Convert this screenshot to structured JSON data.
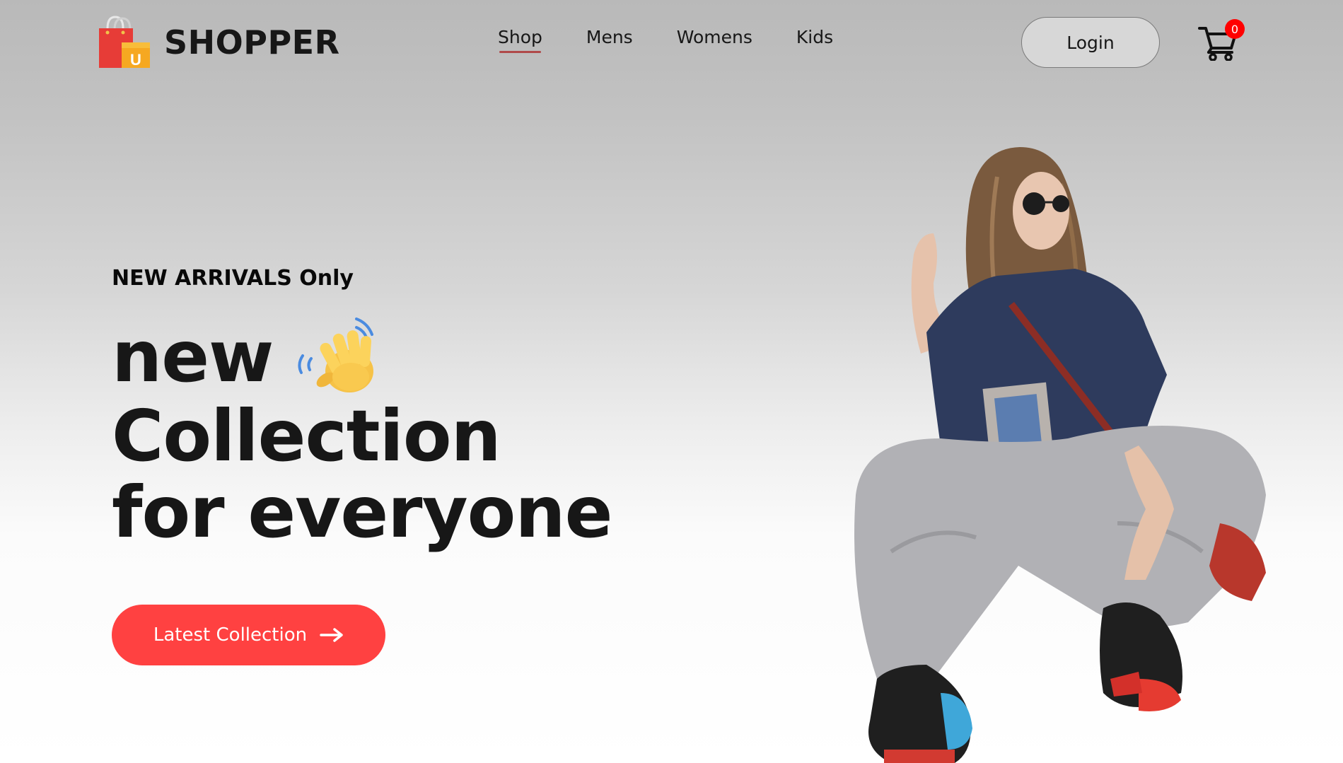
{
  "brand": {
    "name": "SHOPPER",
    "logo_icon": "shopping-bag-icon"
  },
  "nav": {
    "items": [
      {
        "label": "Shop",
        "active": true
      },
      {
        "label": "Mens",
        "active": false
      },
      {
        "label": "Womens",
        "active": false
      },
      {
        "label": "Kids",
        "active": false
      }
    ]
  },
  "header": {
    "login_label": "Login",
    "cart_icon": "cart-icon",
    "cart_count": "0"
  },
  "hero": {
    "tag": "NEW ARRIVALS Only",
    "line1": "new",
    "line1_icon": "waving-hand-icon",
    "line2": "Collection",
    "line3": "for everyone",
    "button_label": "Latest Collection",
    "button_icon": "arrow-right-icon",
    "image": "hero-model-image"
  },
  "colors": {
    "accent": "#ff4141",
    "nav_underline": "#b04a4a",
    "badge": "#ff0000",
    "text": "#171717"
  }
}
